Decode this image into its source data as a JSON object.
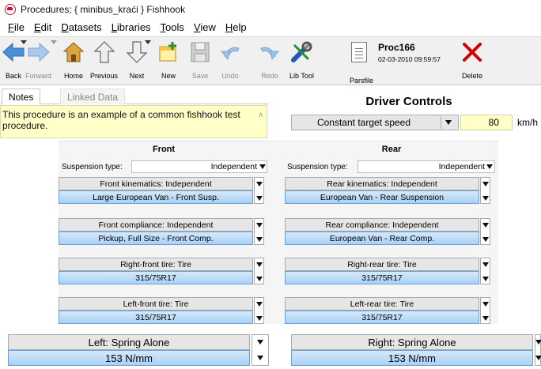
{
  "window": {
    "title": "Procedures; { minibus_kraći }  Fishhook"
  },
  "menu": [
    "File",
    "Edit",
    "Datasets",
    "Libraries",
    "Tools",
    "View",
    "Help"
  ],
  "menu_accel": [
    "F",
    "E",
    "D",
    "L",
    "T",
    "V",
    "H"
  ],
  "toolbar": {
    "back": "Back",
    "forward": "Forward",
    "home": "Home",
    "previous": "Previous",
    "next": "Next",
    "new": "New",
    "save": "Save",
    "undo": "Undo",
    "redo": "Redo",
    "lib_tool": "Lib Tool",
    "parsfile": "Parsfile",
    "delete": "Delete",
    "proc_name": "Proc166",
    "proc_date": "02-03-2010 09:59:57"
  },
  "tabs": [
    "Notes",
    "Linked Data"
  ],
  "notes": {
    "text": "This procedure is an example of a common fishhook test procedure."
  },
  "driver": {
    "heading": "Driver Controls",
    "speed_mode": "Constant target speed",
    "speed_value": "80",
    "speed_unit": "km/h"
  },
  "front": {
    "heading": "Front",
    "susp_type_label": "Suspension type:",
    "susp_type": "Independent",
    "kinematics_header": "Front kinematics: Independent",
    "kinematics_value": "Large European Van - Front Susp.",
    "compliance_header": "Front compliance: Independent",
    "compliance_value": "Pickup, Full Size - Front Comp.",
    "right_tire_header": "Right-front tire: Tire",
    "right_tire_value": "315/75R17",
    "left_tire_header": "Left-front tire: Tire",
    "left_tire_value": "315/75R17"
  },
  "rear": {
    "heading": "Rear",
    "susp_type_label": "Suspension type:",
    "susp_type": "Independent",
    "kinematics_header": "Rear kinematics: Independent",
    "kinematics_value": "European Van - Rear Suspension",
    "compliance_header": "Rear compliance: Independent",
    "compliance_value": "European Van - Rear Comp.",
    "right_tire_header": "Right-rear tire: Tire",
    "right_tire_value": "315/75R17",
    "left_tire_header": "Left-rear tire: Tire",
    "left_tire_value": "315/75R17"
  },
  "springs": {
    "left_header": "Left: Spring Alone",
    "left_value": "153 N/mm",
    "right_header": "Right: Spring Alone",
    "right_value": "153 N/mm"
  },
  "colors": {
    "accent_blue": "#4a90d9",
    "note_yellow": "#ffffc8",
    "delete_red": "#d40000",
    "lib_blue": "#1e5bb8",
    "icon_green": "#2e8b3a"
  }
}
